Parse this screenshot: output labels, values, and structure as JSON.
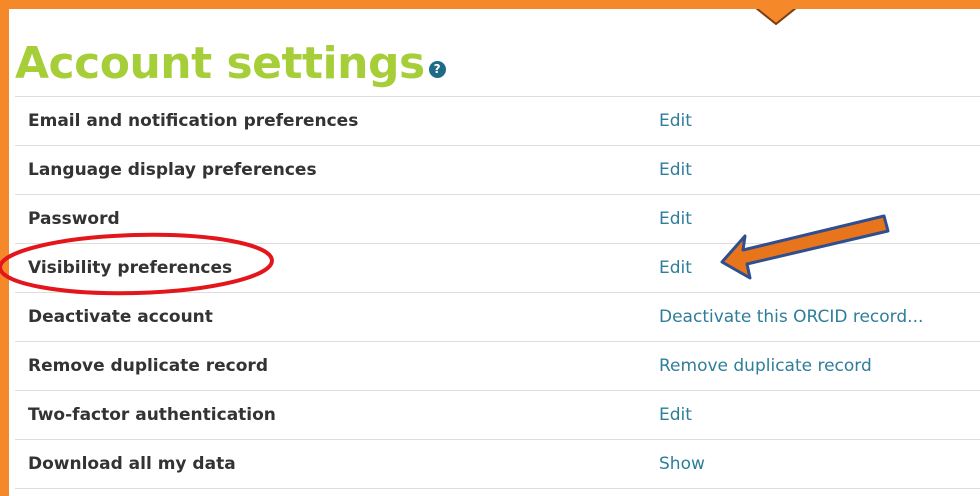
{
  "page": {
    "title": "Account settings",
    "help_icon_glyph": "?"
  },
  "settings": [
    {
      "label": "Email and notification preferences",
      "action": "Edit"
    },
    {
      "label": "Language display preferences",
      "action": "Edit"
    },
    {
      "label": "Password",
      "action": "Edit"
    },
    {
      "label": "Visibility preferences",
      "action": "Edit"
    },
    {
      "label": "Deactivate account",
      "action": "Deactivate this ORCID record..."
    },
    {
      "label": "Remove duplicate record",
      "action": "Remove duplicate record"
    },
    {
      "label": "Two-factor authentication",
      "action": "Edit"
    },
    {
      "label": "Download all my data",
      "action": "Show"
    }
  ],
  "colors": {
    "frame": "#f5892a",
    "title": "#a6ce39",
    "link": "#2e7d9a",
    "label": "#333333",
    "help_icon": "#1f6b86",
    "highlight_circle": "#e3161b",
    "arrow_fill": "#e8741c",
    "arrow_outline": "#2f4f8f"
  },
  "icons": {
    "help": "question-circle-icon"
  }
}
